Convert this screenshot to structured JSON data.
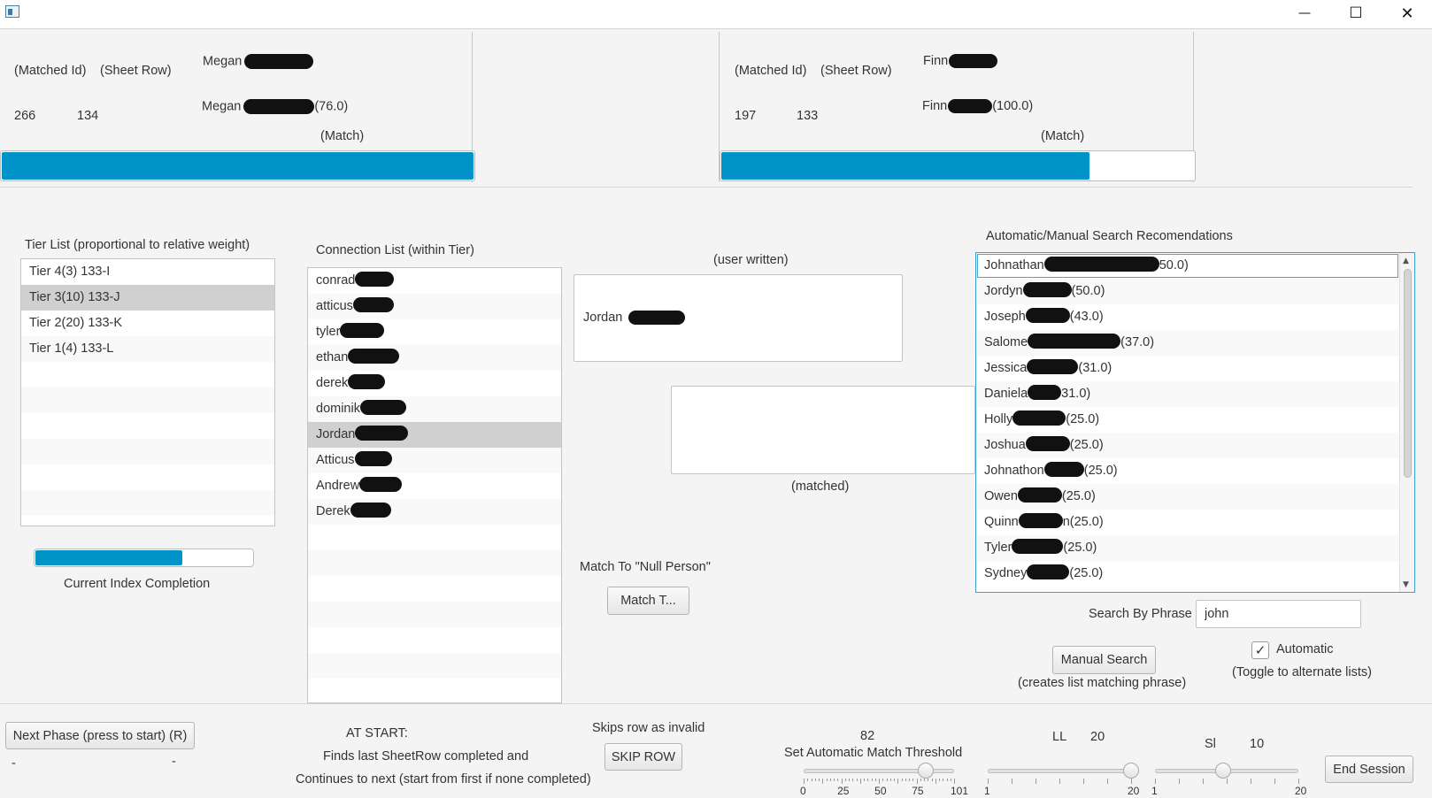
{
  "window": {
    "controls": {
      "minimize": "—",
      "maximize": "☐",
      "close": "✕"
    }
  },
  "panel_left": {
    "matched_id_label": "(Matched Id)",
    "sheet_row_label": "(Sheet Row)",
    "name_top": "Megan",
    "matched_id": "266",
    "sheet_row": "134",
    "name_bottom": "Megan",
    "score": "(76.0)",
    "match_label": "(Match)",
    "progress": 1.0
  },
  "panel_right": {
    "matched_id_label": "(Matched Id)",
    "sheet_row_label": "(Sheet Row)",
    "name_top": "Finn",
    "matched_id": "197",
    "sheet_row": "133",
    "name_bottom": "Finn",
    "score": "(100.0)",
    "match_label": "(Match)",
    "progress": 0.78
  },
  "tier_list": {
    "title": "Tier List  (proportional to relative weight)",
    "items": [
      "Tier 4(3)  133-I",
      "Tier 3(10)  133-J",
      "Tier 2(20)  133-K",
      "Tier 1(4)  133-L"
    ],
    "selected_index": 1,
    "progress": 0.68,
    "progress_label": "Current Index Completion"
  },
  "connection_list": {
    "title": "Connection List (within Tier)",
    "items": [
      "conrad",
      "atticus",
      "tyler",
      "ethan",
      "derek",
      "dominik",
      "Jordan",
      "Atticus",
      "Andrew",
      "Derek"
    ],
    "selected_index": 6
  },
  "user_written": {
    "label": "(user written)",
    "value": "Jordan"
  },
  "matched": {
    "label": "(matched)",
    "value": ""
  },
  "null_person": {
    "label": "Match To \"Null Person\"",
    "button": "Match T..."
  },
  "recommendations": {
    "title": "Automatic/Manual Search Recomendations",
    "items": [
      {
        "name": "Johnathan",
        "score": "50.0)"
      },
      {
        "name": "Jordyn",
        "score": "(50.0)"
      },
      {
        "name": "Joseph",
        "score": "(43.0)"
      },
      {
        "name": "Salome",
        "score": "(37.0)"
      },
      {
        "name": "Jessica",
        "score": "(31.0)"
      },
      {
        "name": "Daniela",
        "score": "31.0)"
      },
      {
        "name": "Holly",
        "score": "(25.0)"
      },
      {
        "name": "Joshua",
        "score": "(25.0)"
      },
      {
        "name": "Johnathon",
        "score": "(25.0)"
      },
      {
        "name": "Owen",
        "score": "(25.0)"
      },
      {
        "name": "Quinn",
        "score": "n(25.0)"
      },
      {
        "name": "Tyler",
        "score": "(25.0)"
      },
      {
        "name": "Sydney",
        "score": "(25.0)"
      }
    ],
    "selected_index": 0
  },
  "search": {
    "label": "Search By Phrase",
    "value": "john",
    "manual_button": "Manual Search",
    "manual_caption": "(creates list matching phrase)",
    "automatic_label": "Automatic",
    "automatic_checked": true,
    "automatic_caption": "(Toggle to alternate lists)"
  },
  "footer": {
    "next_phase_button": "Next Phase (press to start) (R)",
    "dash_left": "-",
    "dash_right": "-",
    "at_start_title": "AT START:",
    "at_start_line1": "Finds last SheetRow completed and",
    "at_start_line2": "Continues to next (start from first if none completed)",
    "skip_caption": "Skips row as invalid",
    "skip_button": "SKIP ROW",
    "threshold": {
      "value": "82",
      "label": "Set Automatic Match Threshold",
      "min": 0,
      "max": 101,
      "current": 82,
      "tick_labels": [
        "0",
        "25",
        "50",
        "75",
        "101"
      ]
    },
    "ll": {
      "label": "LL",
      "value": "20",
      "min": 1,
      "max": 20,
      "current": 20,
      "min_label": "1",
      "max_label": "20"
    },
    "sl": {
      "label": "Sl",
      "value": "10",
      "min": 1,
      "max": 20,
      "current": 10,
      "min_label": "1",
      "max_label": "20"
    },
    "end_button": "End Session"
  }
}
